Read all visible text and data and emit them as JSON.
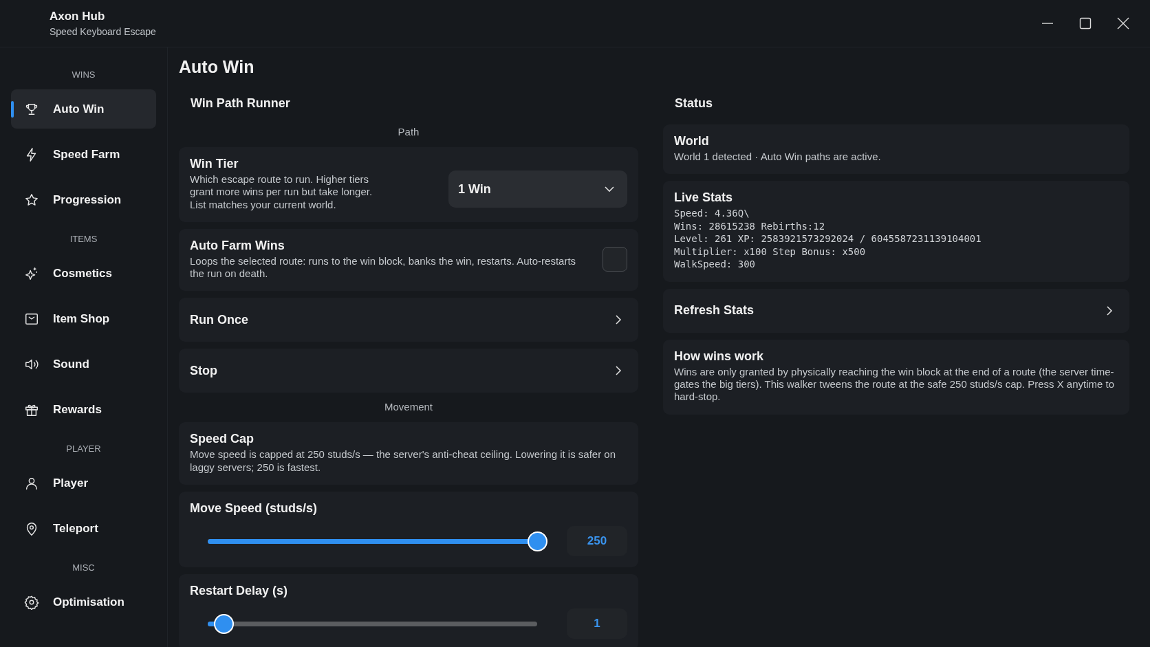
{
  "window": {
    "title": "Axon Hub",
    "subtitle": "Speed Keyboard Escape"
  },
  "sidebar": {
    "sections": [
      {
        "label": "WINS",
        "items": [
          {
            "label": "Auto Win",
            "selected": true
          },
          {
            "label": "Speed Farm",
            "selected": false
          },
          {
            "label": "Progression",
            "selected": false
          }
        ]
      },
      {
        "label": "ITEMS",
        "items": [
          {
            "label": "Cosmetics",
            "selected": false
          },
          {
            "label": "Item Shop",
            "selected": false
          },
          {
            "label": "Sound",
            "selected": false
          },
          {
            "label": "Rewards",
            "selected": false
          }
        ]
      },
      {
        "label": "PLAYER",
        "items": [
          {
            "label": "Player",
            "selected": false
          },
          {
            "label": "Teleport",
            "selected": false
          }
        ]
      },
      {
        "label": "MISC",
        "items": [
          {
            "label": "Optimisation",
            "selected": false
          }
        ]
      }
    ]
  },
  "page_title": "Auto Win",
  "left": {
    "title": "Win Path Runner",
    "items": [
      {
        "kind": "section",
        "label": "Path"
      },
      {
        "kind": "dropdown",
        "title": "Win Tier",
        "description": "Which escape route to run. Higher tiers grant more wins per run but take longer. List matches your current world.",
        "value": "1 Win"
      },
      {
        "kind": "toggle",
        "title": "Auto Farm Wins",
        "description": "Loops the selected route: runs to the win block, banks the win, restarts. Auto-restarts the run on death.",
        "checked": false
      },
      {
        "kind": "button",
        "title": "Run Once"
      },
      {
        "kind": "button",
        "title": "Stop"
      },
      {
        "kind": "section",
        "label": "Movement"
      },
      {
        "kind": "info",
        "title": "Speed Cap",
        "description": "Move speed is capped at 250 studs/s — the server's anti-cheat ceiling. Lowering it is safer on laggy servers; 250 is fastest."
      },
      {
        "kind": "slider",
        "title": "Move Speed (studs/s)",
        "level": 1,
        "reading": "250"
      },
      {
        "kind": "slider",
        "title": "Restart Delay (s)",
        "level": 0.05,
        "reading": "1"
      }
    ]
  },
  "right": {
    "title": "Status",
    "items": [
      {
        "kind": "info",
        "title": "World",
        "description": "World 1 detected · Auto Win paths are active."
      },
      {
        "kind": "stats",
        "title": "Live Stats",
        "lines": [
          "Speed: 4.36Q\\",
          "Wins: 28615238  Rebirths:12",
          "Level: 261 XP: 2583921573292024 / 6045587231139104001",
          "Multiplier: x100 Step Bonus: x500",
          "WalkSpeed:  300"
        ]
      },
      {
        "kind": "button",
        "title": "Refresh Stats"
      },
      {
        "kind": "info",
        "title": "How wins work",
        "description": "Wins are only granted by physically reaching the win block at the end of a route (the server time-gates the big tiers). This walker tweens the route at the safe 250 studs/s cap. Press X anytime to hard-stop."
      }
    ]
  }
}
